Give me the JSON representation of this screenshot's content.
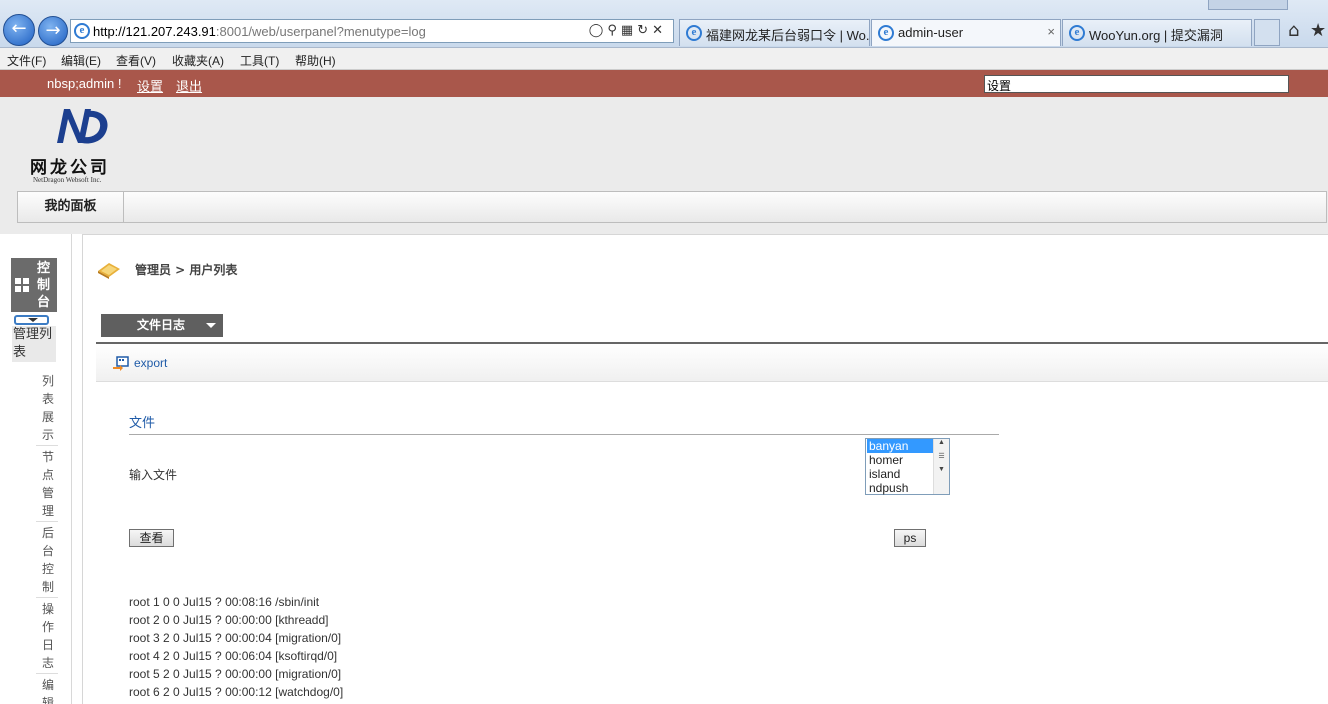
{
  "browser": {
    "url_host": "http://121.207.243.91",
    "url_rest": ":8001/web/userpanel?menutype=log",
    "tabs": [
      {
        "label": "福建网龙某后台弱口令 | Wo...",
        "active": false
      },
      {
        "label": "admin-user",
        "active": true
      },
      {
        "label": "WooYun.org | 提交漏洞",
        "active": false
      }
    ],
    "tab_close": "×",
    "menu": [
      "文件(F)",
      "编辑(E)",
      "查看(V)",
      "收藏夹(A)",
      "工具(T)",
      "帮助(H)"
    ]
  },
  "topbar": {
    "greeting": "nbsp;admin !",
    "settings": "设置",
    "logout": "退出",
    "input_value": "设置"
  },
  "logo": {
    "cn": "网龙公司",
    "en": "NetDragon Websoft Inc."
  },
  "nav": {
    "my_panel": "我的面板"
  },
  "sidebar": {
    "console": "控制台",
    "manage_list": "管理列表",
    "items": [
      "列表展示",
      "节点管理",
      "后台控制",
      "操作日志",
      "编辑"
    ]
  },
  "main": {
    "breadcrumb": "管理员 > 用户列表",
    "dropdown_label": "文件日志",
    "export": "export",
    "file_section": "文件",
    "input_file_label": "输入文件",
    "file_options": [
      "banyan",
      "homer",
      "island",
      "ndpush"
    ],
    "selected_option": "banyan",
    "view_button": "查看",
    "ps_button": "ps",
    "ps_lines": [
      "root 1 0 0 Jul15 ? 00:08:16 /sbin/init",
      "root 2 0 0 Jul15 ? 00:00:00 [kthreadd]",
      "root 3 2 0 Jul15 ? 00:00:04 [migration/0]",
      "root 4 2 0 Jul15 ? 00:06:04 [ksoftirqd/0]",
      "root 5 2 0 Jul15 ? 00:00:00 [migration/0]",
      "root 6 2 0 Jul15 ? 00:00:12 [watchdog/0]"
    ]
  },
  "colors": {
    "topbar": "#a9574b",
    "link": "#1f5ba8",
    "selection": "#3399ff"
  }
}
